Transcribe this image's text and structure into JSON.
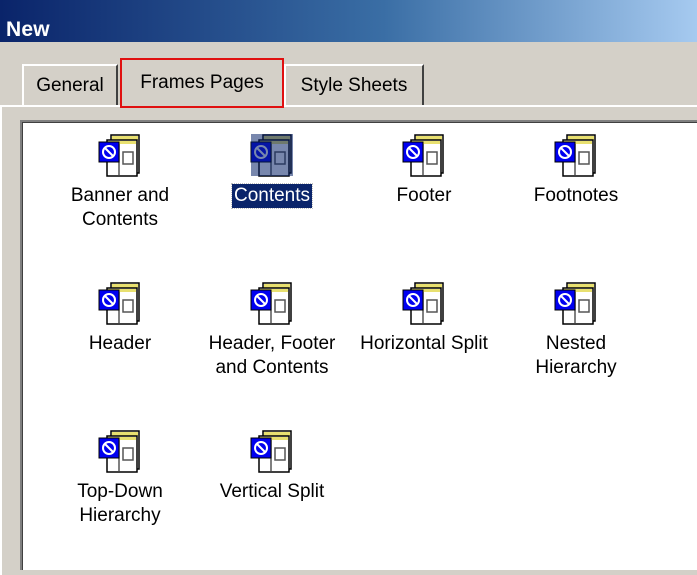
{
  "window": {
    "title": "New"
  },
  "tabs": [
    {
      "label": "General",
      "active": false
    },
    {
      "label": "Frames Pages",
      "active": true
    },
    {
      "label": "Style Sheets",
      "active": false
    }
  ],
  "templates": [
    {
      "label": "Banner and\nContents",
      "icon": "frames-page-icon",
      "selected": false
    },
    {
      "label": "Contents",
      "icon": "frames-page-icon",
      "selected": true
    },
    {
      "label": "Footer",
      "icon": "frames-page-icon",
      "selected": false
    },
    {
      "label": "Footnotes",
      "icon": "frames-page-icon",
      "selected": false
    },
    {
      "label": "Header",
      "icon": "frames-page-icon",
      "selected": false
    },
    {
      "label": "Header, Footer\nand Contents",
      "icon": "frames-page-icon",
      "selected": false
    },
    {
      "label": "Horizontal Split",
      "icon": "frames-page-icon",
      "selected": false
    },
    {
      "label": "Nested\nHierarchy",
      "icon": "frames-page-icon",
      "selected": false
    },
    {
      "label": "Top-Down\nHierarchy",
      "icon": "frames-page-icon",
      "selected": false
    },
    {
      "label": "Vertical Split",
      "icon": "frames-page-icon",
      "selected": false
    }
  ],
  "colors": {
    "title_bar_start": "#0a246a",
    "title_bar_end": "#a6caf0",
    "dialog_face": "#d4d0c8",
    "selection": "#0a246a",
    "active_tab_highlight": "#e01010"
  }
}
